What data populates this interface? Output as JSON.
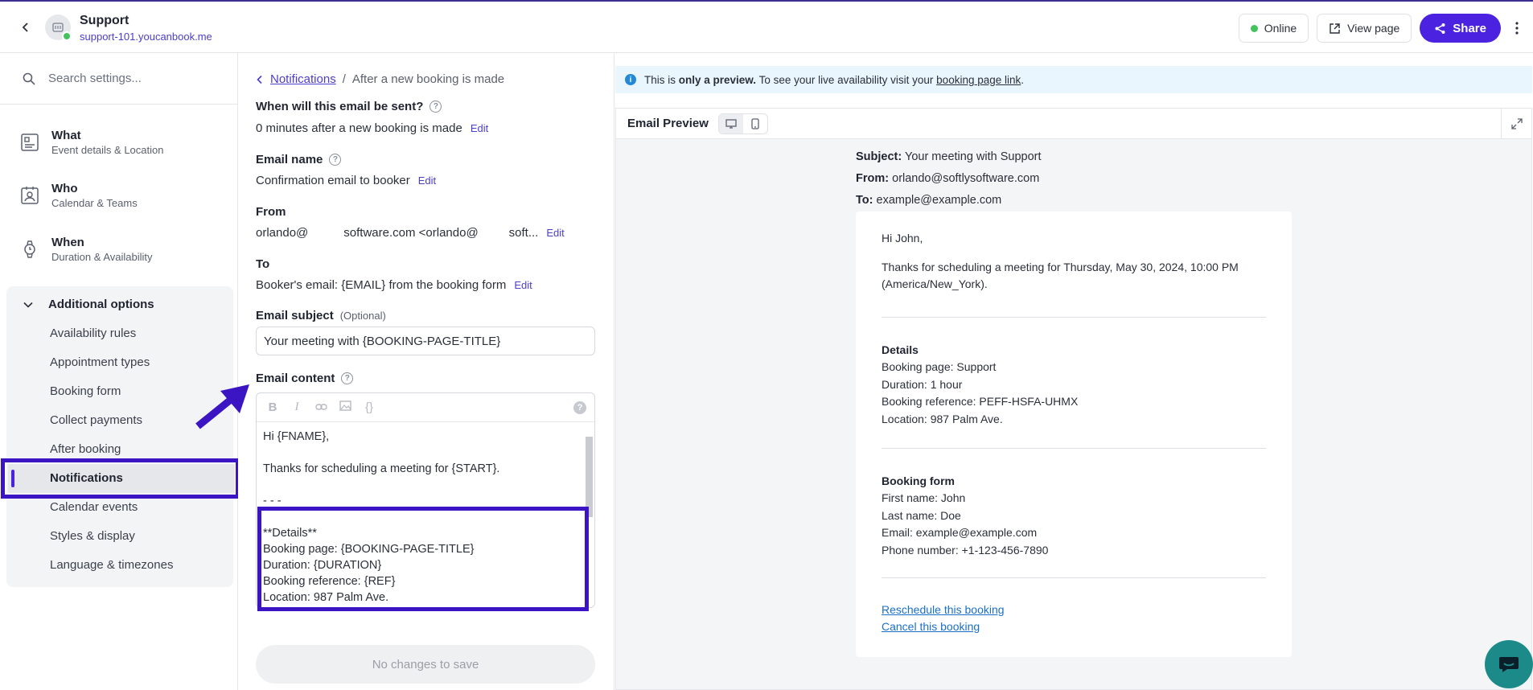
{
  "header": {
    "app_name": "Support",
    "app_url": "support-101.youcanbook.me",
    "status_label": "Online",
    "view_page_label": "View page",
    "share_label": "Share"
  },
  "sidebar": {
    "search_placeholder": "Search settings...",
    "nav": [
      {
        "title": "What",
        "subtitle": "Event details & Location",
        "icon": "document-icon"
      },
      {
        "title": "Who",
        "subtitle": "Calendar & Teams",
        "icon": "contact-card-icon"
      },
      {
        "title": "When",
        "subtitle": "Duration & Availability",
        "icon": "watch-icon"
      }
    ],
    "additional_title": "Additional options",
    "additional_items": [
      "Availability rules",
      "Appointment types",
      "Booking form",
      "Collect payments",
      "After booking",
      "Notifications",
      "Calendar events",
      "Styles & display",
      "Language & timezones"
    ],
    "active_item": "Notifications"
  },
  "form": {
    "breadcrumb_link": "Notifications",
    "breadcrumb_sep": "/",
    "breadcrumb_current": "After a new booking is made",
    "when_label": "When will this email be sent?",
    "when_value": "0 minutes after a new booking is made",
    "email_name_label": "Email name",
    "email_name_value": "Confirmation email to booker",
    "from_label": "From",
    "from_value_1": "orlando@",
    "from_value_2": "software.com <orlando@",
    "from_value_3": "soft...",
    "to_label": "To",
    "to_value": "Booker's email: {EMAIL} from the booking form",
    "edit_label": "Edit",
    "subject_label": "Email subject",
    "subject_optional": "(Optional)",
    "subject_value": "Your meeting with {BOOKING-PAGE-TITLE}",
    "content_label": "Email content",
    "editor_lines": [
      "Hi {FNAME},",
      "",
      "Thanks for scheduling a meeting for {START}.",
      "",
      "- - -",
      "",
      "**Details**",
      "Booking page: {BOOKING-PAGE-TITLE}",
      "Duration: {DURATION}",
      "Booking reference: {REF}",
      "Location: 987 Palm Ave."
    ],
    "save_label": "No changes to save"
  },
  "preview": {
    "notice_prefix": "This is ",
    "notice_bold": "only a preview.",
    "notice_middle": " To see your live availability visit your ",
    "notice_link": "booking page link",
    "notice_end": ".",
    "title": "Email Preview",
    "subject_key": "Subject:",
    "subject_value": "Your meeting with Support",
    "from_key": "From:",
    "from_value": "orlando@softlysoftware.com",
    "to_key": "To:",
    "to_value": "example@example.com",
    "greeting": "Hi John,",
    "thanks_line1": "Thanks for scheduling a meeting for Thursday, May 30, 2024, 10:00 PM",
    "thanks_line2": "(America/New_York).",
    "details_title": "Details",
    "details": [
      "Booking page: Support",
      "Duration: 1 hour",
      "Booking reference: PEFF-HSFA-UHMX",
      "Location: 987 Palm Ave."
    ],
    "form_title": "Booking form",
    "form_fields": [
      "First name: John",
      "Last name: Doe",
      "Email: example@example.com",
      "Phone number: +1-123-456-7890"
    ],
    "reschedule_link": "Reschedule this booking",
    "cancel_link": "Cancel this booking"
  },
  "colors": {
    "accent": "#4a22e0",
    "highlight_box": "#3b15c4",
    "online": "#42c35c",
    "link": "#1a6fc9"
  }
}
